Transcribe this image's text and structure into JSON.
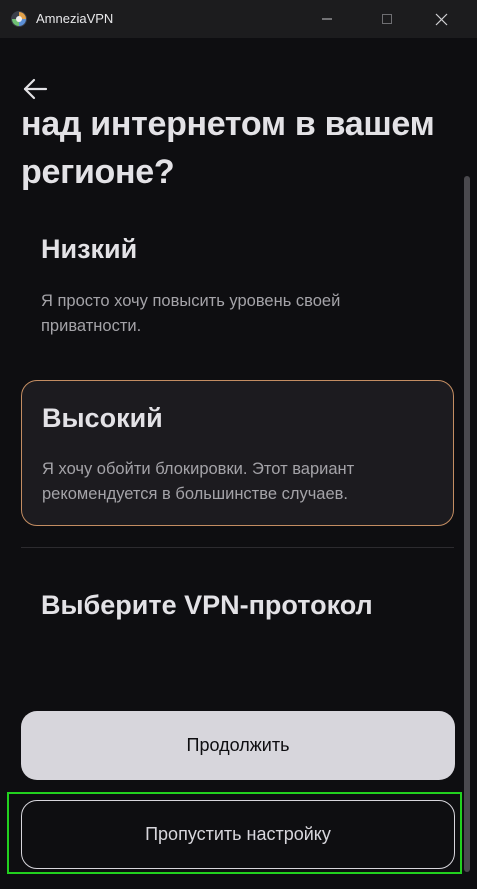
{
  "window": {
    "title": "AmneziaVPN"
  },
  "page": {
    "heading": "над интернетом в вашем регионе?",
    "options": [
      {
        "title": "Низкий",
        "description": "Я просто хочу повысить уровень своей приватности.",
        "selected": false
      },
      {
        "title": "Высокий",
        "description": "Я хочу обойти блокировки. Этот вариант рекомендуется в большинстве случаев.",
        "selected": true
      }
    ],
    "protocol_title": "Выберите VPN-протокол",
    "continue_label": "Продолжить",
    "skip_label": "Пропустить настройку"
  },
  "icons": {
    "app": "amnezia-logo-icon",
    "back": "back-arrow-icon",
    "minimize": "minimize-icon",
    "maximize": "maximize-icon",
    "close": "close-icon"
  },
  "colors": {
    "background": "#0e0e11",
    "selected_border": "#c38d62",
    "primary_button": "#d7d6dc",
    "highlight": "#22d11f"
  }
}
